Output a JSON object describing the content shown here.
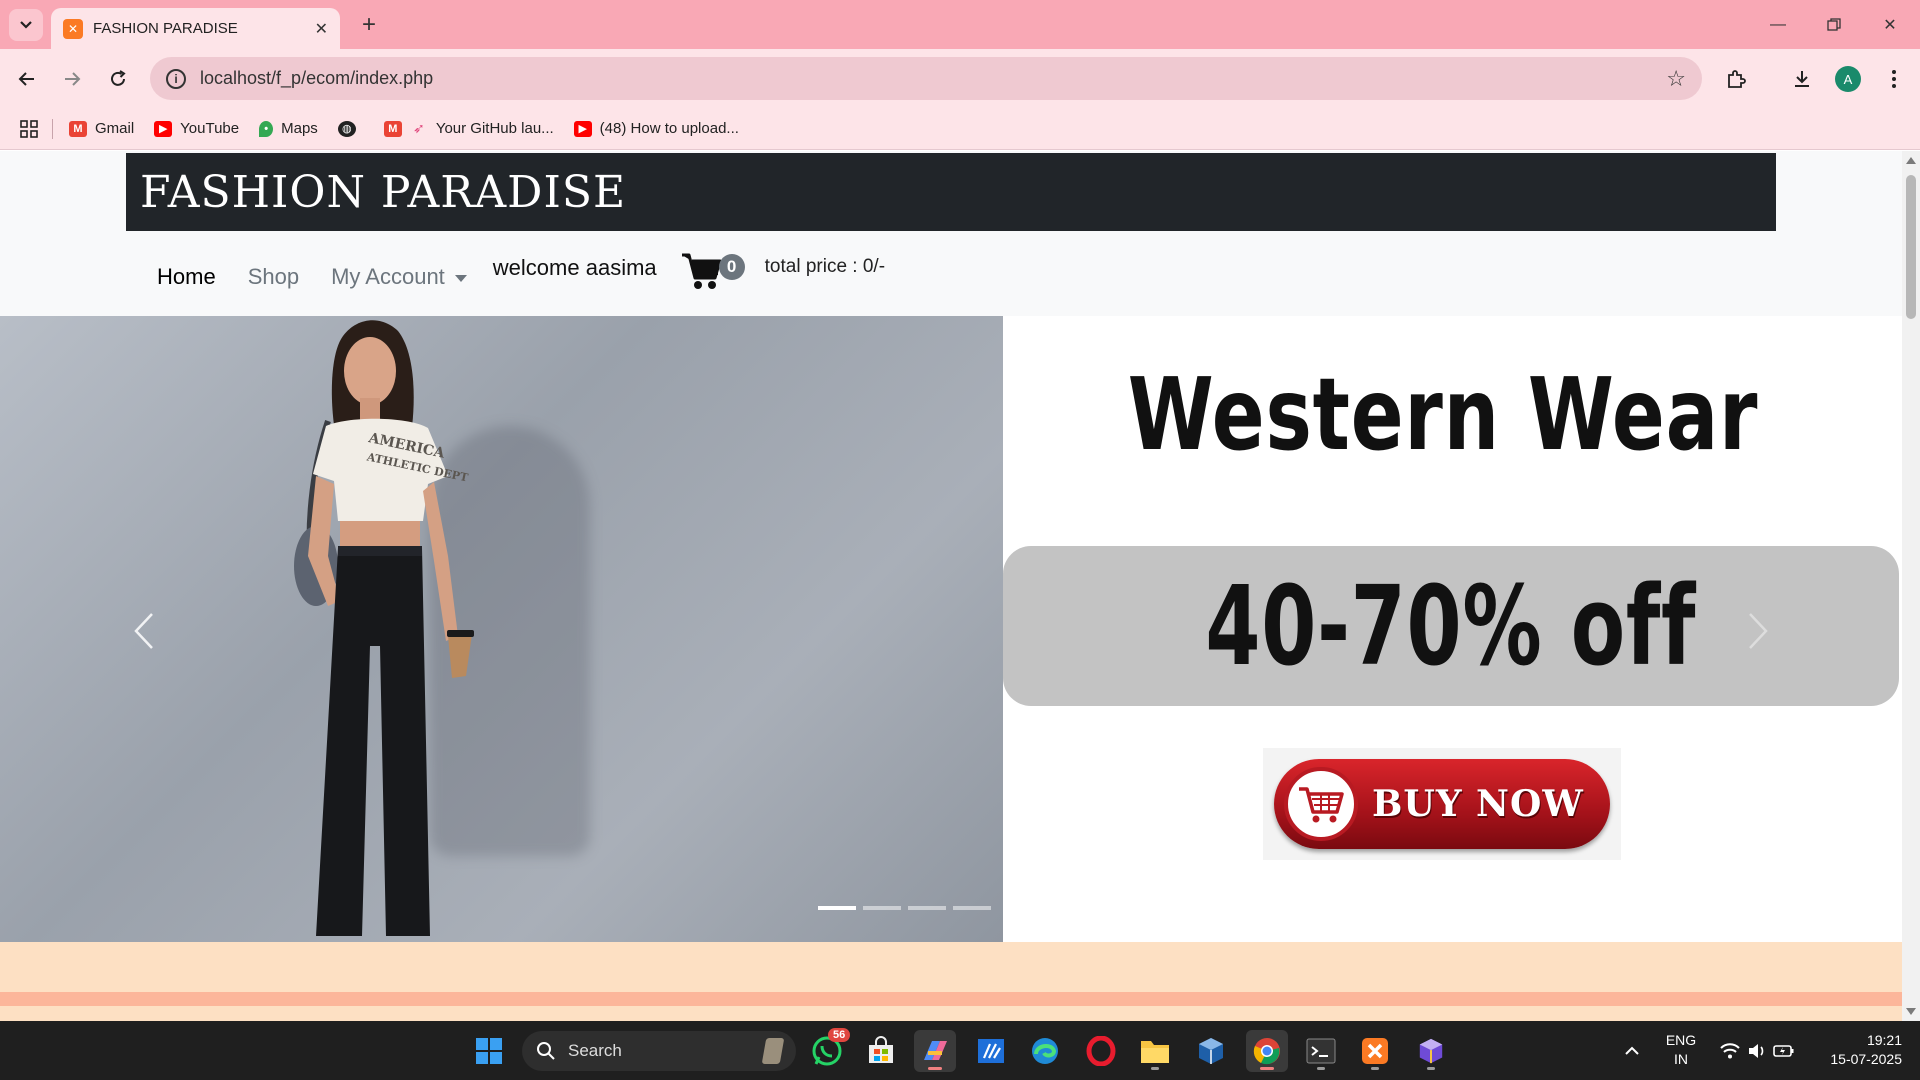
{
  "browser": {
    "tab_title": "FASHION PARADISE",
    "url": "localhost/f_p/ecom/index.php",
    "profile_initial": "A",
    "bookmarks": [
      {
        "label": "Gmail",
        "icon": "gmail-icon",
        "color": "#ea4335"
      },
      {
        "label": "YouTube",
        "icon": "youtube-icon",
        "color": "#ff0000"
      },
      {
        "label": "Maps",
        "icon": "maps-icon",
        "color": "#34a853"
      },
      {
        "label": "",
        "icon": "globe-icon",
        "color": "#333333"
      },
      {
        "label": "Your GitHub lau...",
        "icon": "gmail-icon",
        "color": "#ea4335"
      },
      {
        "label": "(48) How to upload...",
        "icon": "youtube-icon",
        "color": "#ff0000"
      }
    ]
  },
  "site": {
    "brand": "FASHION PARADISE",
    "nav": {
      "home": "Home",
      "shop": "Shop",
      "account": "My Account",
      "welcome": "welcome aasima",
      "cart_count": "0",
      "total_price": "total price : 0/-"
    },
    "hero": {
      "heading": "Western Wear",
      "discount": "40-70% off",
      "cta": "BUY NOW",
      "shirt_text_1": "AMERICA",
      "shirt_text_2": "ATHLETIC DEPT",
      "slides_count": 4,
      "active_slide": 1
    }
  },
  "taskbar": {
    "search_label": "Search",
    "whatsapp_badge": "56",
    "lang_top": "ENG",
    "lang_bottom": "IN",
    "time": "19:21",
    "date": "15-07-2025"
  },
  "colors": {
    "tab_strip": "#f9a8b5",
    "toolbar": "#fde4e8",
    "brand_bar": "#212529",
    "band_light": "#fde0c3",
    "band_salmon": "#fcb69a"
  }
}
